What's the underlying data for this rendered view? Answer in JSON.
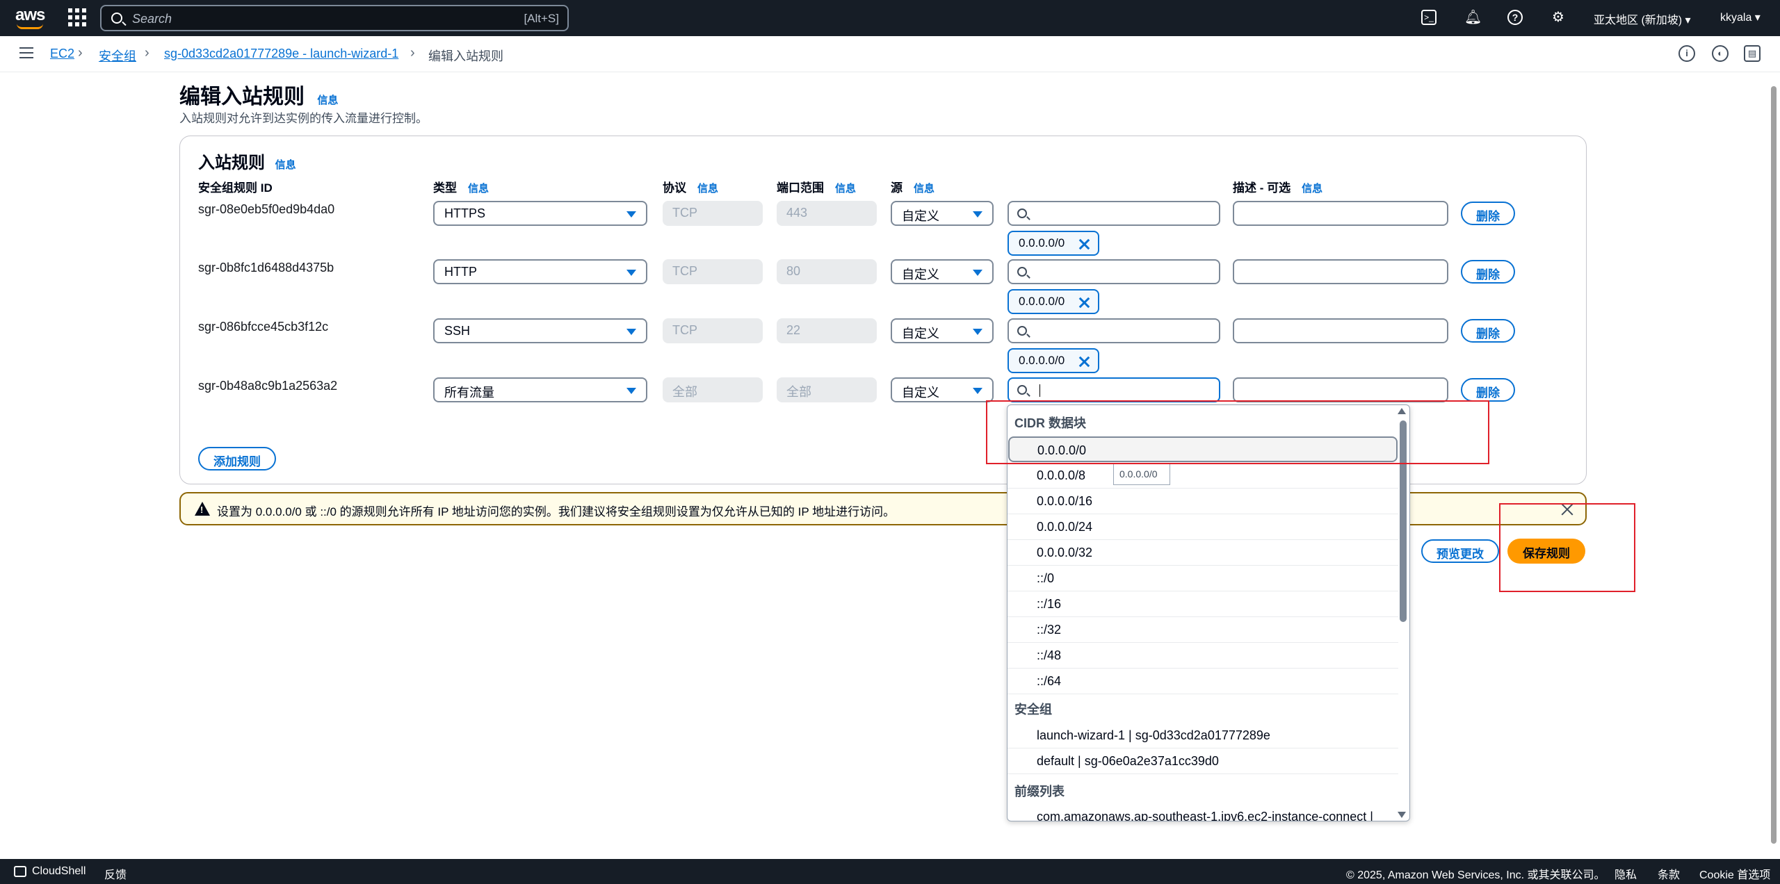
{
  "topnav": {
    "logo": "aws",
    "search_placeholder": "Search",
    "search_shortcut": "[Alt+S]",
    "region": "亚太地区 (新加坡) ▾",
    "user": "kkyala ▾"
  },
  "breadcrumb": {
    "items": [
      "EC2",
      "安全组",
      "sg-0d33cd2a01777289e - launch-wizard-1"
    ],
    "current": "编辑入站规则"
  },
  "page": {
    "title": "编辑入站规则",
    "info": "信息",
    "description": "入站规则对允许到达实例的传入流量进行控制。"
  },
  "rules": {
    "title": "入站规则",
    "columns": {
      "id": "安全组规则 ID",
      "type": "类型",
      "protocol": "协议",
      "port": "端口范围",
      "source": "源",
      "description": "描述 - 可选"
    },
    "rows": [
      {
        "id": "sgr-08e0eb5f0ed9b4da0",
        "type": "HTTPS",
        "protocol": "TCP",
        "port": "443",
        "source": "自定义",
        "token": "0.0.0.0/0"
      },
      {
        "id": "sgr-0b8fc1d6488d4375b",
        "type": "HTTP",
        "protocol": "TCP",
        "port": "80",
        "source": "自定义",
        "token": "0.0.0.0/0"
      },
      {
        "id": "sgr-086bfcce45cb3f12c",
        "type": "SSH",
        "protocol": "TCP",
        "port": "22",
        "source": "自定义",
        "token": "0.0.0.0/0"
      },
      {
        "id": "sgr-0b48a8c9b1a2563a2",
        "type": "所有流量",
        "protocol": "全部",
        "port": "全部",
        "source": "自定义",
        "token": ""
      }
    ],
    "delete_label": "删除",
    "add_rule": "添加规则"
  },
  "warning": {
    "text": "设置为 0.0.0.0/0 或 ::/0 的源规则允许所有 IP 地址访问您的实例。我们建议将安全组规则设置为仅允许从已知的 IP 地址进行访问。"
  },
  "actions": {
    "preview": "预览更改",
    "save": "保存规则"
  },
  "dropdown": {
    "group_cidr": "CIDR 数据块",
    "cidr_options": [
      "0.0.0.0/0",
      "0.0.0.0/8",
      "0.0.0.0/16",
      "0.0.0.0/24",
      "0.0.0.0/32",
      "::/0",
      "::/16",
      "::/32",
      "::/48",
      "::/64"
    ],
    "group_sg": "安全组",
    "sg_options": [
      "launch-wizard-1 | sg-0d33cd2a01777289e",
      "default | sg-06e0a2e37a1cc39d0"
    ],
    "group_prefix": "前缀列表",
    "prefix_options": [
      "com.amazonaws.ap-southeast-1.ipv6.ec2-instance-connect |"
    ],
    "tooltip": "0.0.0.0/0"
  },
  "footer": {
    "cloudshell": "CloudShell",
    "feedback": "反馈",
    "copyright": "© 2025, Amazon Web Services, Inc. 或其关联公司。",
    "privacy": "隐私",
    "terms": "条款",
    "cookies": "Cookie 首选项"
  }
}
